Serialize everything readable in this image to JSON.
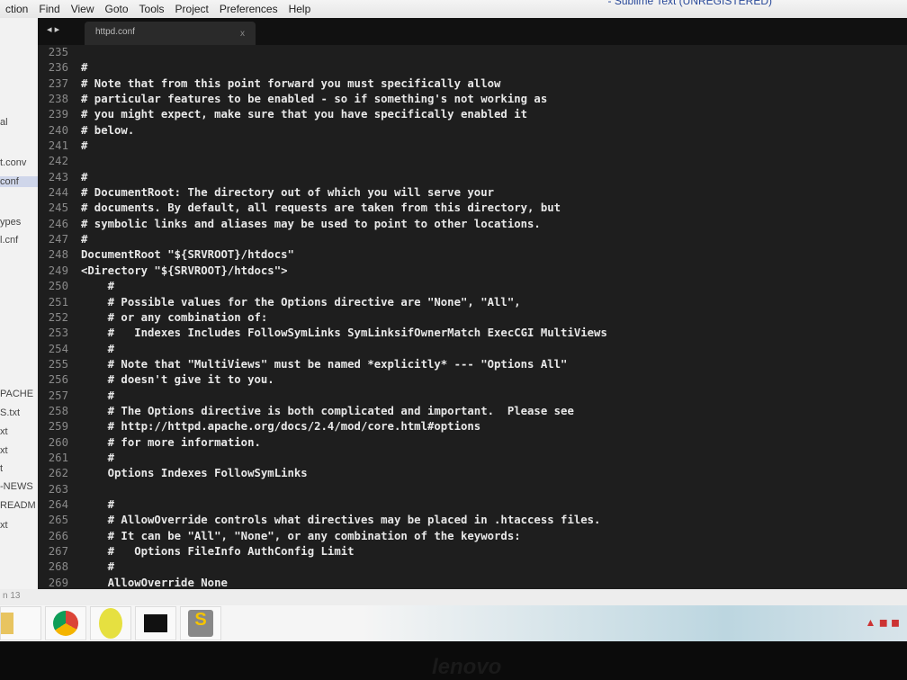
{
  "menu": [
    "ction",
    "Find",
    "View",
    "Goto",
    "Tools",
    "Project",
    "Preferences",
    "Help"
  ],
  "window_title": "- Sublime Text (UNREGISTERED)",
  "sidebar": {
    "items": [
      "al",
      "t.conv",
      "conf",
      "ypes",
      "l.cnf",
      "PACHE",
      "S.txt",
      "xt",
      "xt",
      "t",
      "-NEWS",
      "READM",
      "xt"
    ],
    "selected": "conf"
  },
  "tab": {
    "label": "httpd.conf",
    "close": "x",
    "nav": "◂ ▸"
  },
  "code": [
    {
      "n": "235",
      "t": ""
    },
    {
      "n": "236",
      "t": "#"
    },
    {
      "n": "237",
      "t": "# Note that from this point forward you must specifically allow"
    },
    {
      "n": "238",
      "t": "# particular features to be enabled - so if something's not working as"
    },
    {
      "n": "239",
      "t": "# you might expect, make sure that you have specifically enabled it"
    },
    {
      "n": "240",
      "t": "# below."
    },
    {
      "n": "241",
      "t": "#"
    },
    {
      "n": "242",
      "t": ""
    },
    {
      "n": "243",
      "t": "#"
    },
    {
      "n": "244",
      "t": "# DocumentRoot: The directory out of which you will serve your"
    },
    {
      "n": "245",
      "t": "# documents. By default, all requests are taken from this directory, but"
    },
    {
      "n": "246",
      "t": "# symbolic links and aliases may be used to point to other locations."
    },
    {
      "n": "247",
      "t": "#"
    },
    {
      "n": "248",
      "t": "DocumentRoot \"${SRVROOT}/htdocs\""
    },
    {
      "n": "249",
      "t": "<Directory \"${SRVROOT}/htdocs\">"
    },
    {
      "n": "250",
      "t": "    #"
    },
    {
      "n": "251",
      "t": "    # Possible values for the Options directive are \"None\", \"All\","
    },
    {
      "n": "252",
      "t": "    # or any combination of:"
    },
    {
      "n": "253",
      "t": "    #   Indexes Includes FollowSymLinks SymLinksifOwnerMatch ExecCGI MultiViews"
    },
    {
      "n": "254",
      "t": "    #"
    },
    {
      "n": "255",
      "t": "    # Note that \"MultiViews\" must be named *explicitly* --- \"Options All\""
    },
    {
      "n": "256",
      "t": "    # doesn't give it to you."
    },
    {
      "n": "257",
      "t": "    #"
    },
    {
      "n": "258",
      "t": "    # The Options directive is both complicated and important.  Please see"
    },
    {
      "n": "259",
      "t": "    # http://httpd.apache.org/docs/2.4/mod/core.html#options"
    },
    {
      "n": "260",
      "t": "    # for more information."
    },
    {
      "n": "261",
      "t": "    #"
    },
    {
      "n": "262",
      "t": "    Options Indexes FollowSymLinks"
    },
    {
      "n": "263",
      "t": ""
    },
    {
      "n": "264",
      "t": "    #"
    },
    {
      "n": "265",
      "t": "    # AllowOverride controls what directives may be placed in .htaccess files."
    },
    {
      "n": "266",
      "t": "    # It can be \"All\", \"None\", or any combination of the keywords:"
    },
    {
      "n": "267",
      "t": "    #   Options FileInfo AuthConfig Limit"
    },
    {
      "n": "268",
      "t": "    #"
    },
    {
      "n": "269",
      "t": "    AllowOverride None"
    }
  ],
  "status": "n 13",
  "taskbar": [
    "explorer",
    "chrome",
    "app",
    "cmd",
    "sublime-text"
  ],
  "brand": "lenovo"
}
